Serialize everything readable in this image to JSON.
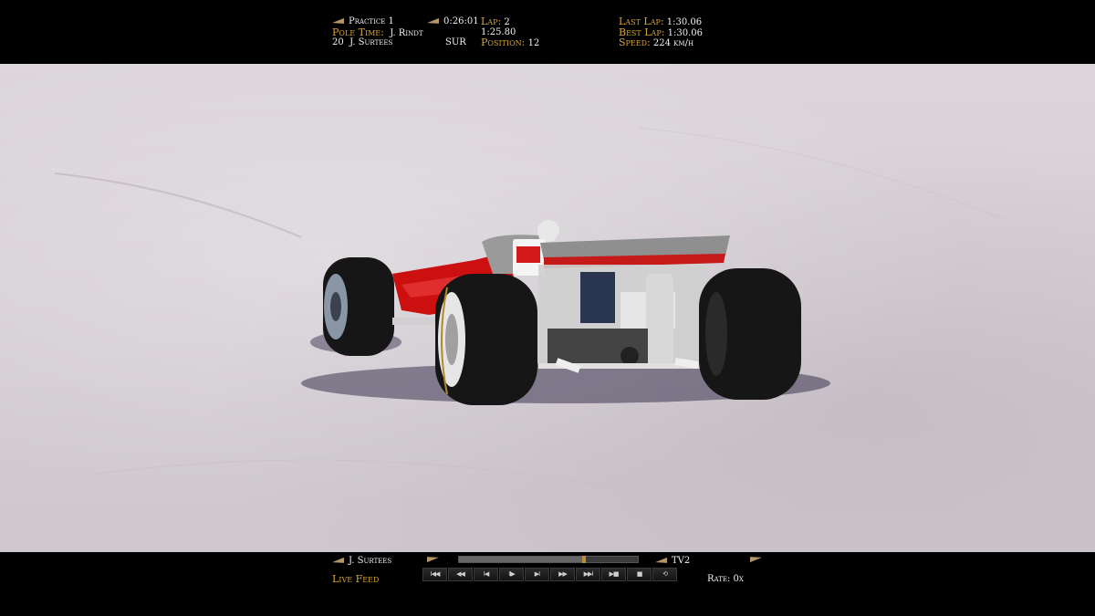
{
  "hud_top": {
    "session": "Practice 1",
    "session_time": "0:26:01",
    "lap_label": "Lap:",
    "lap_value": "2",
    "last_lap_label": "Last Lap:",
    "last_lap_value": "1:30.06",
    "pole_time_label": "Pole Time:",
    "pole_driver": "J. Rindt",
    "pole_time_value": "1:25.80",
    "best_lap_label": "Best Lap:",
    "best_lap_value": "1:30.06",
    "car_number": "20",
    "driver": "J. Surtees",
    "driver_code": "SUR",
    "position_label": "Position:",
    "position_value": "12",
    "speed_label": "Speed:",
    "speed_value": "224 km/h"
  },
  "hud_bottom": {
    "driver": "J. Surtees",
    "feed": "Live Feed",
    "camera": "TV2",
    "rate_label": "Rate:",
    "rate_value": "0x",
    "replay_progress": 0.7,
    "controls": [
      "I◀◀",
      "◀◀",
      "I◀",
      "II▶",
      "▶I",
      "▶▶",
      "▶▶I",
      "▶■",
      "■",
      "⟲"
    ]
  },
  "colors": {
    "label_gold": "#d7a534",
    "text_white": "#f2f2f2",
    "car_red": "#cc1010"
  }
}
